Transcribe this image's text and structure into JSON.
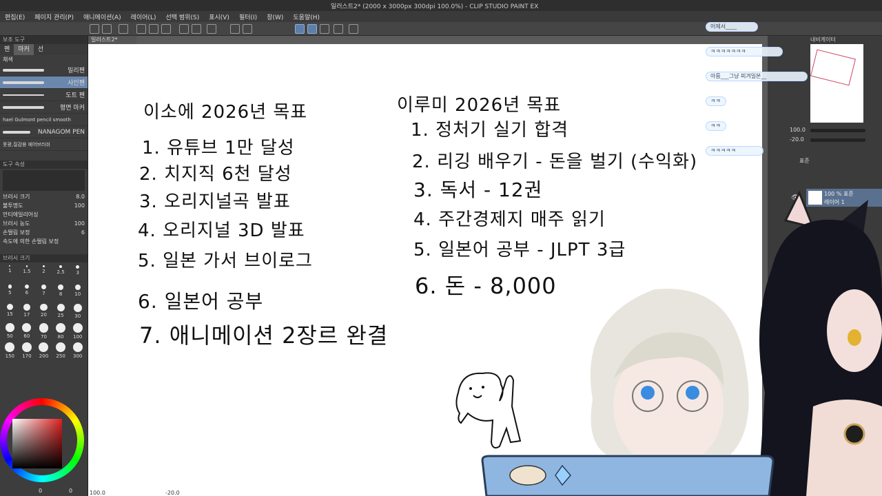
{
  "window": {
    "title": "일러스트2* (2000 x 3000px 300dpi 100.0%) - CLIP STUDIO PAINT EX"
  },
  "menu": [
    "편집(E)",
    "페이지 관리(P)",
    "애니메이션(A)",
    "레이어(L)",
    "선택 범위(S)",
    "표시(V)",
    "필터(I)",
    "창(W)",
    "도움말(H)"
  ],
  "left_panel": {
    "header": "보조 도구",
    "tabs": [
      "펜",
      "마커",
      "선"
    ],
    "section_label": "채색",
    "brushes": [
      "밀리펜",
      "사인펜",
      "도트 펜",
      "평면 마커",
      "hael Gulmont pencil smooth",
      "NANAGOM PEN",
      "못광,질감용 에어브러쉬"
    ],
    "tool_property_header": "도구 속성",
    "properties": [
      {
        "label": "브러시 크기",
        "value": "8.0"
      },
      {
        "label": "불투명도",
        "value": "100"
      },
      {
        "label": "안티에일리어싱",
        "value": ""
      },
      {
        "label": "브러시 농도",
        "value": "100"
      },
      {
        "label": "손떨림 보정",
        "value": "6"
      },
      {
        "label": "속도에 의한 손떨림 보정",
        "value": ""
      }
    ],
    "brush_size_header": "브러시 크기",
    "sizes": [
      "1",
      "1.5",
      "2",
      "2.5",
      "3",
      "5",
      "6",
      "7",
      "8",
      "10",
      "15",
      "17",
      "20",
      "25",
      "30",
      "50",
      "60",
      "70",
      "80",
      "100",
      "150",
      "170",
      "200",
      "250",
      "300"
    ],
    "footer_values": [
      "0",
      "0"
    ]
  },
  "canvas": {
    "doc_tab": "일러스트2*",
    "left_column": {
      "title": "이소에 2026년 목표",
      "items": [
        "1. 유튜브 1만 달성",
        "2. 치지직 6천 달성",
        "3. 오리지널곡 발표",
        "4. 오리지널 3D 발표",
        "5. 일본 가서 브이로그",
        "6. 일본어 공부",
        "7. 애니메이션 2장르 완결"
      ]
    },
    "right_column": {
      "title": "이루미 2026년 목표",
      "items": [
        "1. 정처기 실기 합격",
        "2. 리깅 배우기 - 돈을 벌기 (수익화)",
        "3. 독서 - 12권",
        "4. 주간경제지 매주 읽기",
        "5. 일본어 공부 - JLPT 3급",
        "6. 돈 - 8,000"
      ]
    },
    "status_left": "100.0",
    "status_mid": "-20.0"
  },
  "right_panel": {
    "navigator_tab": "내비게이터",
    "zoom": "100.0",
    "rotation": "-20.0",
    "blend_mode": "표준",
    "layer_opacity_blend": "100 % 표준",
    "layer_name": "레이어 1"
  },
  "chat": [
    "어제서____",
    "ㅋㅋㅋㅋㅋㅋㅋ",
    "아름___그냥 피겨일본__",
    "ㅋㅋ",
    "ㅋㅋ",
    "ㅋㅋㅋㅋㅋ"
  ],
  "colors": {
    "accent": "#6b87ad",
    "panel": "#3d3d3d",
    "canvas": "#ffffff"
  }
}
